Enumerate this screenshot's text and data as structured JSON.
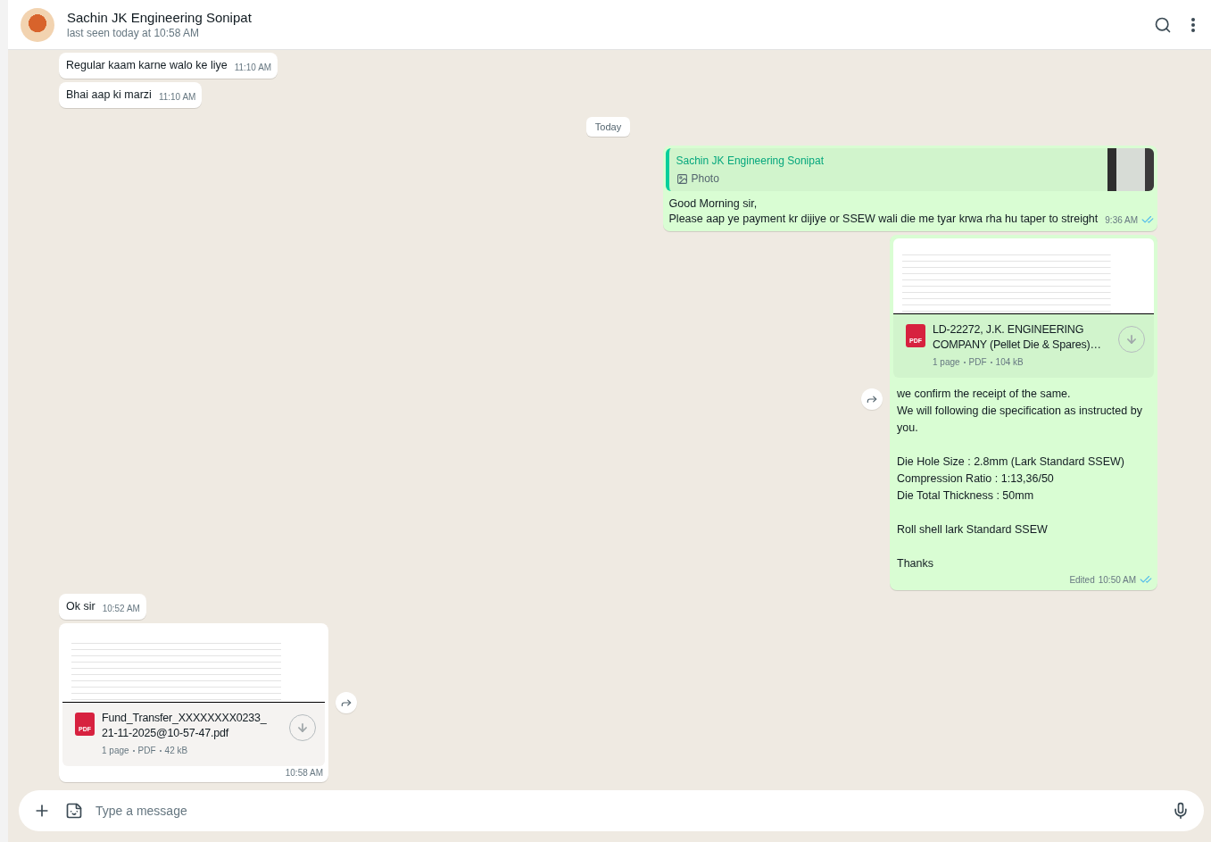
{
  "header": {
    "name": "Sachin JK Engineering Sonipat",
    "status": "last seen today at 10:58 AM"
  },
  "messages": [
    {
      "kind": "text",
      "outgoing": false,
      "text": "Regular kaam karne walo ke liye",
      "time": "11:10 AM"
    },
    {
      "kind": "text",
      "outgoing": false,
      "text": "Bhai aap ki marzi",
      "time": "11:10 AM"
    },
    {
      "kind": "date",
      "text": "Today"
    },
    {
      "kind": "reply",
      "outgoing": true,
      "quote": {
        "author": "Sachin JK Engineering Sonipat",
        "label": "Photo"
      },
      "text": "Good Morning sir,\nPlease aap ye payment kr dijiye or SSEW wali die me tyar krwa rha hu taper to streight",
      "time": "9:36 AM",
      "read": true
    },
    {
      "kind": "document",
      "outgoing": true,
      "badge": "PDF",
      "name": "LD-22272, J.K. ENGINEERING COMPANY (Pellet Die & Spares)…",
      "meta": [
        "1 page",
        "PDF",
        "104 kB"
      ],
      "caption": "we confirm the receipt of the same.\nWe will following die specification as instructed by you.\n\nDie Hole Size : 2.8mm (Lark Standard SSEW)\nCompression Ratio : 1:13,36/50\nDie Total Thickness : 50mm\n\nRoll shell lark Standard SSEW\n\nThanks",
      "edited": "Edited",
      "time": "10:50 AM",
      "read": true
    },
    {
      "kind": "text",
      "outgoing": false,
      "text": "Ok sir",
      "time": "10:52 AM"
    },
    {
      "kind": "document",
      "outgoing": false,
      "badge": "PDF",
      "name": "Fund_Transfer_XXXXXXXX0233_\n21-11-2025@10-57-47.pdf",
      "meta": [
        "1 page",
        "PDF",
        "42 kB"
      ],
      "time": "10:58 AM"
    }
  ],
  "composer": {
    "placeholder": "Type a message"
  }
}
